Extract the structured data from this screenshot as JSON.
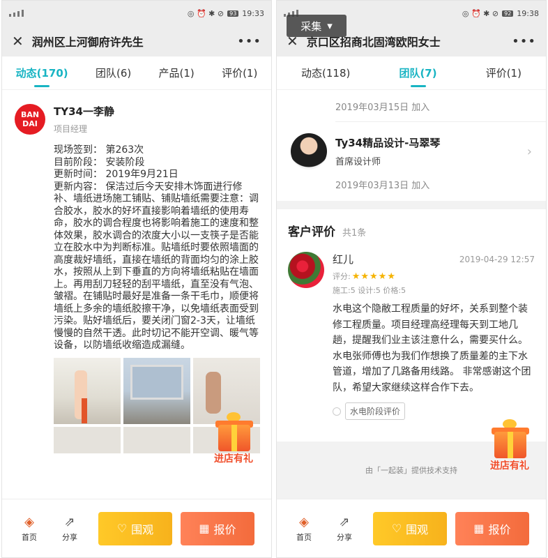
{
  "left": {
    "status": {
      "time": "19:33",
      "battery": "93"
    },
    "titlebar": {
      "close": "✕",
      "title": "润州区上河御府许先生",
      "more": "•••"
    },
    "tabs": [
      {
        "label": "动态(170)"
      },
      {
        "label": "团队(6)"
      },
      {
        "label": "产品(1)"
      },
      {
        "label": "评价(1)"
      }
    ],
    "post": {
      "logo_line1": "BAN",
      "logo_line2": "DAI",
      "name": "TY34一李静",
      "role": "项目经理",
      "checkin": "现场签到：  第263次",
      "stage": "目前阶段：  安装阶段",
      "updated": "更新时间：  2019年9月21日",
      "content": "更新内容：  保洁过后今天安排木饰面进行修补、墙纸进场施工铺贴、铺贴墙纸需要注意：调合胶水，胶水的好坏直接影响着墙纸的使用寿命，胶水的调合程度也将影响着施工的速度和整体效果，胶水调合的浓度大小以一支筷子是否能立在胶水中为判断标准。贴墙纸时要依照墙面的高度裁好墙纸，直接在墙纸的背面均匀的涂上胶水，按照从上到下垂直的方向将墙纸粘贴在墙面上。再用刮刀轻轻的刮平墙纸，直至没有气泡、皱褶。在铺贴时最好是准备一条干毛巾，顺便将墙纸上多余的墙纸胶擦干净，以免墙纸表面受到污染。贴好墙纸后，要关闭门窗2-3天，让墙纸慢慢的自然干透。此时切记不能开空调、暖气等设备，以防墙纸收缩造成漏缝。"
    },
    "gift_label": "进店有礼",
    "bottom": {
      "home": "首页",
      "share": "分享",
      "watch": "围观",
      "quote": "报价"
    }
  },
  "right": {
    "status": {
      "time": "19:38",
      "battery": "92"
    },
    "collect": "采集",
    "titlebar": {
      "close": "✕",
      "title": "京口区招商北固湾欧阳女士",
      "more": "•••"
    },
    "tabs": [
      {
        "label": "动态(118)"
      },
      {
        "label": "团队(7)"
      },
      {
        "label": "评价(1)"
      }
    ],
    "prev_joined": "2019年03月15日 加入",
    "member": {
      "name": "Ty34精品设计-马翠琴",
      "title": "首席设计师",
      "joined": "2019年03月13日 加入"
    },
    "reviews": {
      "heading": "客户评价",
      "count": "共1条",
      "name": "红儿",
      "time": "2019-04-29 12:57",
      "score_label": "评分:",
      "stars": "★★★★★",
      "detail": "施工:5 设计:5 价格:5",
      "text": "水电这个隐敝工程质量的好坏，关系到整个装修工程质量。项目经理高经理每天到工地几趟，提醒我们业主该注意什么，需要买什么。 水电张师傅也为我们作想换了质量差的主下水管道，增加了几路备用线路。 非常感谢这个团队，希望大家继续这样合作下去。",
      "tag": "水电阶段评价"
    },
    "footer": "由「一起装」提供技术支持",
    "gift_label": "进店有礼",
    "bottom": {
      "home": "首页",
      "share": "分享",
      "watch": "围观",
      "quote": "报价"
    }
  },
  "colors": {
    "accent": "#18b4c3",
    "watch_btn": "#f7b21c",
    "quote_btn": "#f36b3c",
    "star": "#f5b301"
  }
}
